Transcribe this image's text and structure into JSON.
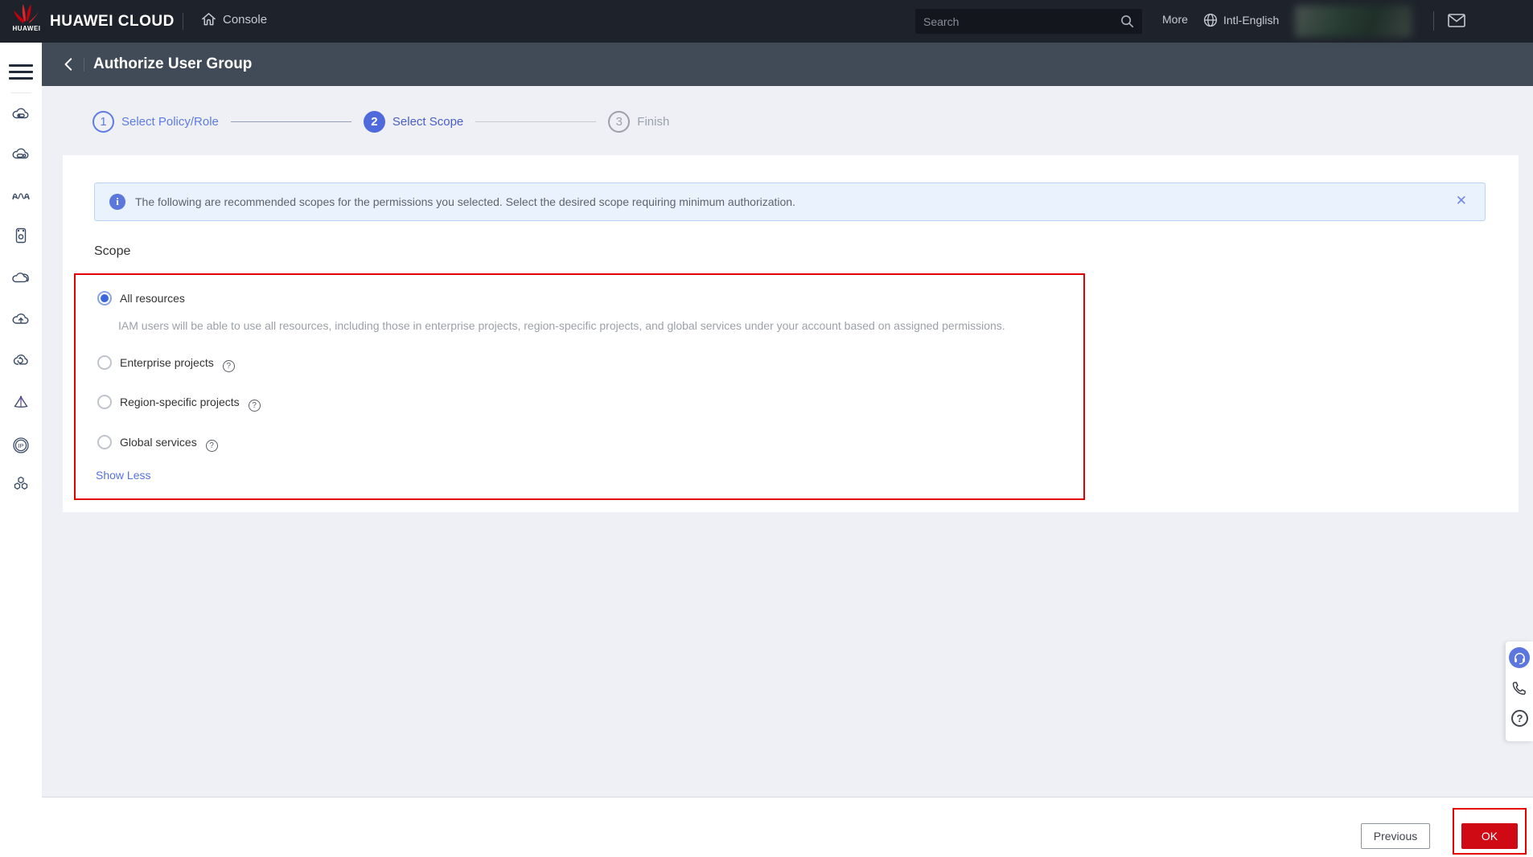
{
  "topbar": {
    "brand": "HUAWEI CLOUD",
    "brand_logo_text": "HUAWEI",
    "console": "Console",
    "search_placeholder": "Search",
    "more": "More",
    "language": "Intl-English"
  },
  "header": {
    "title": "Authorize User Group"
  },
  "steps": [
    {
      "num": "1",
      "label": "Select Policy/Role",
      "state": "done"
    },
    {
      "num": "2",
      "label": "Select Scope",
      "state": "current"
    },
    {
      "num": "3",
      "label": "Finish",
      "state": "pending"
    }
  ],
  "banner": {
    "text": "The following are recommended scopes for the permissions you selected. Select the desired scope requiring minimum authorization.",
    "close_glyph": "✕"
  },
  "scope": {
    "heading": "Scope",
    "options": [
      {
        "label": "All resources",
        "selected": true,
        "description": "IAM users will be able to use all resources, including those in enterprise projects, region-specific projects, and global services under your account based on assigned permissions."
      },
      {
        "label": "Enterprise projects",
        "selected": false,
        "has_help": true
      },
      {
        "label": "Region-specific projects",
        "selected": false,
        "has_help": true
      },
      {
        "label": "Global services",
        "selected": false,
        "has_help": true
      }
    ],
    "help_glyph": "?",
    "show_less": "Show Less"
  },
  "footer": {
    "previous_label": "Previous",
    "ok_label": "OK"
  },
  "sidebar": {
    "eip_label": "IP"
  },
  "side_widget": {
    "question_glyph": "?"
  },
  "colors": {
    "brand_red": "#c7000b",
    "primary_blue": "#5e7ce0",
    "link_blue": "#5672dd",
    "annotation_red": "#e60000",
    "banner_bg": "#e9f2fd",
    "ok_button_bg": "#cf0a15",
    "topbar_bg": "#1e232b",
    "header_bg": "#414a57"
  }
}
